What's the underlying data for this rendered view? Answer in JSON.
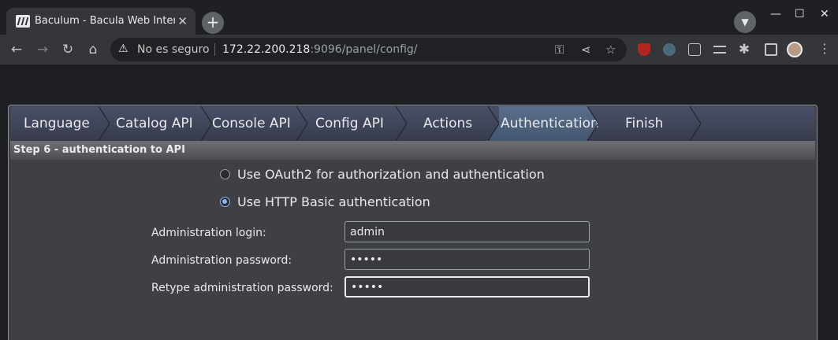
{
  "browser": {
    "tab_title": "Baculum - Bacula Web Interface",
    "new_tab": "+",
    "close_tab": "✕",
    "security_label": "No es seguro",
    "url_host": "172.22.200.218",
    "url_rest": ":9096/panel/config/",
    "window_controls": {
      "minimize": "—",
      "maximize": "☐",
      "close": "✕"
    }
  },
  "wizard": {
    "steps": [
      {
        "label": "Language"
      },
      {
        "label": "Catalog API"
      },
      {
        "label": "Console API"
      },
      {
        "label": "Config API"
      },
      {
        "label": "Actions"
      },
      {
        "label": "Authentication"
      },
      {
        "label": "Finish"
      }
    ],
    "active_step": "Authentication",
    "step_header": "Step 6 - authentication to API"
  },
  "auth": {
    "options": [
      {
        "label": "Use OAuth2 for authorization and authentication",
        "checked": false
      },
      {
        "label": "Use HTTP Basic authentication",
        "checked": true
      }
    ],
    "login_label": "Administration login:",
    "login_value": "admin",
    "password_label": "Administration password:",
    "password_value": "admin",
    "retype_label": "Retype administration password:",
    "retype_value": "admin"
  },
  "colors": {
    "accent": "#8ab4f8",
    "nav_active": "#5a6f8c",
    "panel_bg": "#3f4044"
  }
}
